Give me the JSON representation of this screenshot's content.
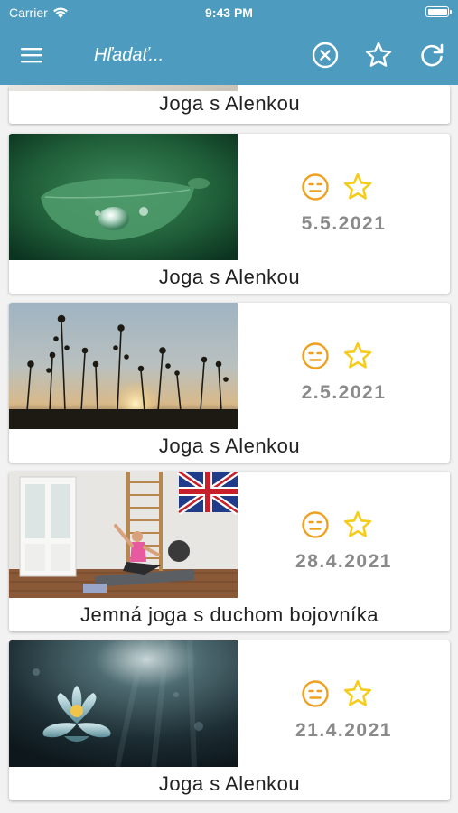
{
  "status_bar": {
    "carrier": "Carrier",
    "time": "9:43 PM"
  },
  "toolbar": {
    "menu_icon": "hamburger-menu-icon",
    "search_placeholder": "Hľadať...",
    "clear_icon": "circle-x-icon",
    "favorite_icon": "star-outline-icon",
    "refresh_icon": "refresh-icon"
  },
  "colors": {
    "header": "#4d9bbf",
    "accent_orange": "#f0a020",
    "star_yellow": "#f5cc1a",
    "date_gray": "#8a8a8a"
  },
  "videos": [
    {
      "title": "Joga s Alenkou",
      "date": "",
      "rating_icon": "neutral-face-icon",
      "favorite_icon": "star-outline-icon"
    },
    {
      "title": "Joga s Alenkou",
      "date": "5.5.2021",
      "rating_icon": "neutral-face-icon",
      "favorite_icon": "star-outline-icon"
    },
    {
      "title": "Joga s Alenkou",
      "date": "2.5.2021",
      "rating_icon": "neutral-face-icon",
      "favorite_icon": "star-outline-icon"
    },
    {
      "title": "Jemná joga s duchom bojovníka",
      "date": "28.4.2021",
      "rating_icon": "neutral-face-icon",
      "favorite_icon": "star-outline-icon"
    },
    {
      "title": "Joga s Alenkou",
      "date": "21.4.2021",
      "rating_icon": "neutral-face-icon",
      "favorite_icon": "star-outline-icon"
    }
  ]
}
